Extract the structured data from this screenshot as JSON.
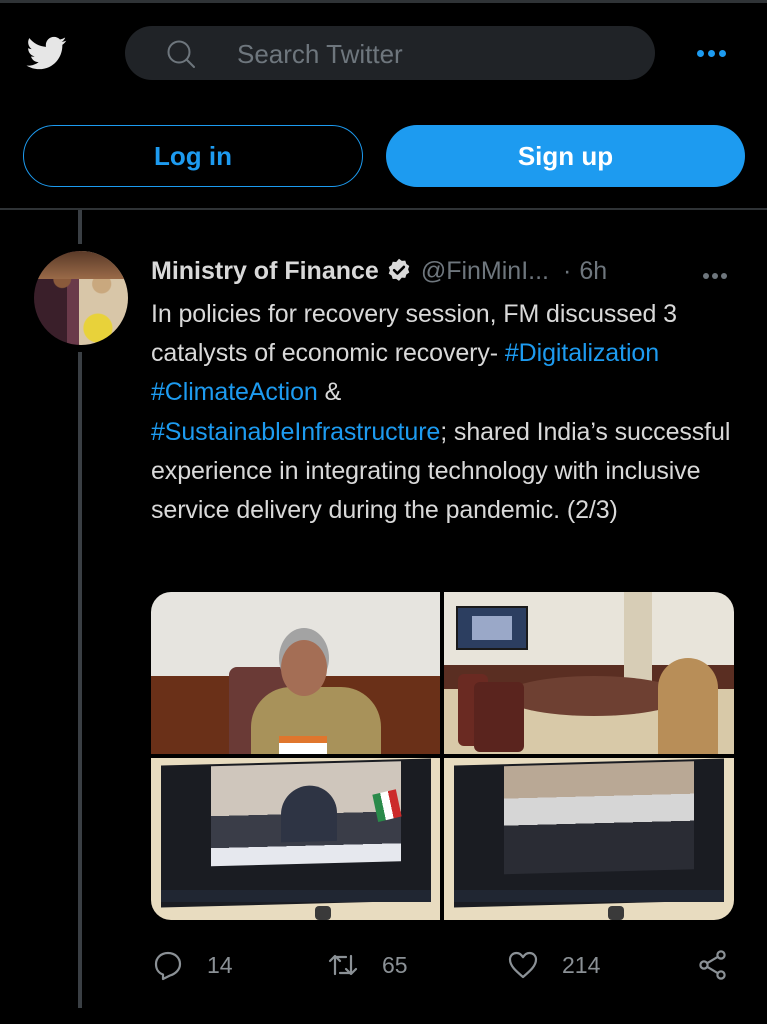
{
  "header": {
    "logo_icon": "twitter-bird-icon",
    "search": {
      "placeholder": "Search Twitter",
      "value": "",
      "icon": "search-icon"
    },
    "more_icon": "more-horizontal-icon"
  },
  "auth": {
    "login_label": "Log in",
    "signup_label": "Sign up"
  },
  "tweet": {
    "author_name": "Ministry of Finance",
    "verified": true,
    "handle": "@FinMinI...",
    "separator": "·",
    "time": "6h",
    "text_parts": [
      {
        "type": "text",
        "value": "In policies for recovery session, FM discussed 3 catalysts of economic recovery- "
      },
      {
        "type": "hashtag",
        "value": "#Digitalization"
      },
      {
        "type": "text",
        "value": " "
      },
      {
        "type": "hashtag",
        "value": "#ClimateAction"
      },
      {
        "type": "text",
        "value": " & "
      },
      {
        "type": "hashtag",
        "value": "#SustainableInfrastructure"
      },
      {
        "type": "text",
        "value": "; shared India’s successful experience in integrating technology with inclusive service delivery during the pandemic. (2/3)"
      }
    ],
    "media": [
      {
        "description": "Finance Minister speaking at desk with Indian flag"
      },
      {
        "description": "Conference room with delegates at oval table and video screen"
      },
      {
        "description": "TV screen showing Italy Ministry of Finance speaker with Italian flag"
      },
      {
        "description": "TV screen showing G20 plenary hall with delegates"
      }
    ],
    "actions": {
      "replies": "14",
      "retweets": "65",
      "likes": "214"
    }
  },
  "colors": {
    "accent": "#1d9bf0",
    "background": "#000000",
    "muted": "#6e767d",
    "text": "#d9d9d9"
  }
}
